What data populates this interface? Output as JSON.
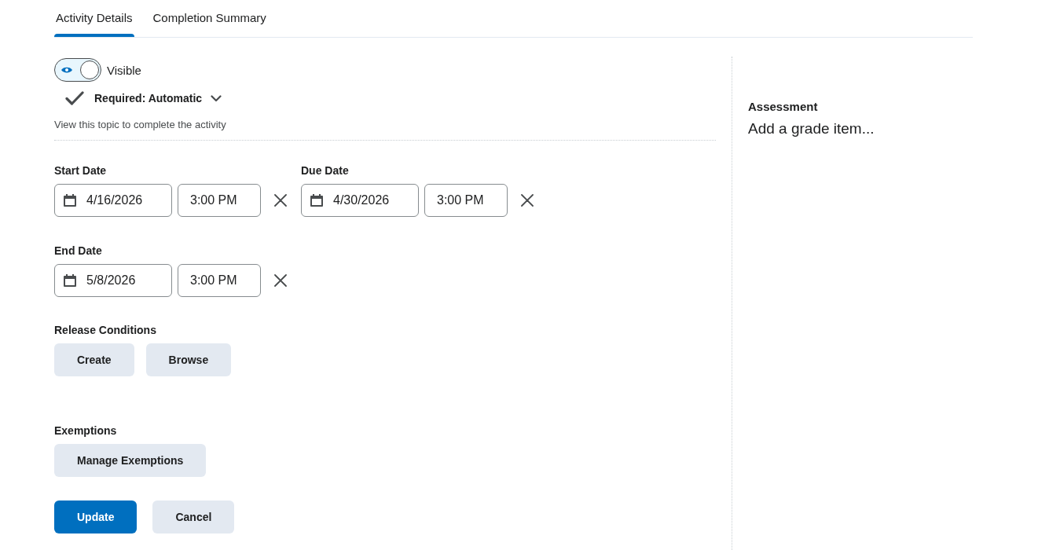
{
  "tabs": [
    {
      "label": "Activity Details",
      "selected": true
    },
    {
      "label": "Completion Summary",
      "selected": false
    }
  ],
  "visibility": {
    "label": "Visible",
    "on": true
  },
  "completion": {
    "label": "Required: Automatic",
    "description": "View this topic to complete the activity"
  },
  "dates": [
    {
      "label": "Start Date",
      "date": "4/16/2026",
      "time": "3:00 PM"
    },
    {
      "label": "Due Date",
      "date": "4/30/2026",
      "time": "3:00 PM"
    },
    {
      "label": "End Date",
      "date": "5/8/2026",
      "time": "3:00 PM"
    }
  ],
  "release_conditions": {
    "label": "Release Conditions",
    "buttons": [
      "Create",
      "Browse"
    ]
  },
  "exemptions": {
    "label": "Exemptions",
    "buttons": [
      "Manage Exemptions"
    ]
  },
  "actions": [
    {
      "label": "Update",
      "kind": "primary"
    },
    {
      "label": "Cancel",
      "kind": "secondary"
    }
  ],
  "assessment": {
    "label": "Assessment",
    "link": "Add a grade item..."
  }
}
